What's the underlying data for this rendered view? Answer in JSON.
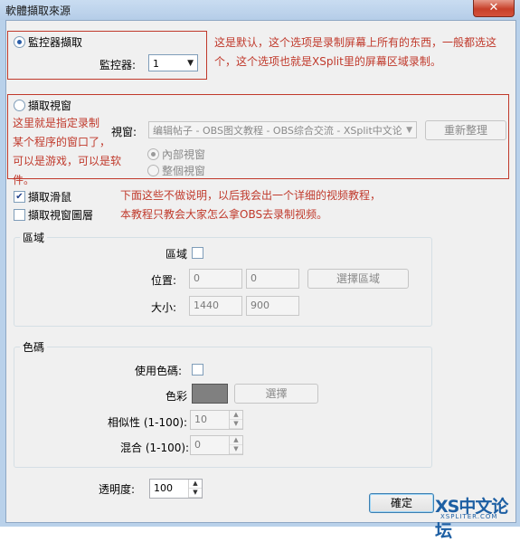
{
  "window": {
    "title": "軟體擷取來源",
    "close_label": "✕"
  },
  "monitor_section": {
    "radio_label": "監控器擷取",
    "monitor_label": "監控器:",
    "monitor_value": "1",
    "note": [
      "这是默认，这个选项是录制屏幕上所有的东西，一般都选这",
      "个，这个选项也就是XSplit里的屏幕区域录制。"
    ]
  },
  "window_section": {
    "radio_label": "擷取視窗",
    "note": [
      "这里就是指定录制",
      "某个程序的窗口了，",
      "可以是游戏，可以是软件。"
    ],
    "window_label": "視窗:",
    "window_value": "编辑帖子 - OBS图文教程 - OBS综合交流 - XSplit中文论",
    "refresh_label": "重新整理",
    "inner_label": "內部視窗",
    "whole_label": "整個視窗"
  },
  "options": {
    "mouse_label": "擷取滑鼠",
    "layered_label": "擷取視窗圖層",
    "note": [
      "下面这些不做说明，以后我会出一个详细的视频教程，",
      "本教程只教会大家怎么拿OBS去录制视频。"
    ]
  },
  "region": {
    "group_label": "區域",
    "region_label": "區域",
    "position_label": "位置:",
    "pos_x": "0",
    "pos_y": "0",
    "select_button": "選擇區域",
    "size_label": "大小:",
    "width": "1440",
    "height": "900"
  },
  "colorkey": {
    "group_label": "色碼",
    "use_label": "使用色碼:",
    "color_label": "色彩",
    "color_value": "#808080",
    "select_button": "選擇",
    "similarity_label": "相似性 (1-100):",
    "similarity_value": "10",
    "blend_label": "混合 (1-100):",
    "blend_value": "0"
  },
  "opacity": {
    "label": "透明度:",
    "value": "100"
  },
  "footer": {
    "ok_label": "確定",
    "watermark_main": "XS中文论坛",
    "watermark_sub": "XSPLITER.COM"
  },
  "icons": {
    "dropdown": "▼",
    "spin_up": "▲",
    "spin_down": "▼",
    "check": "✔"
  }
}
